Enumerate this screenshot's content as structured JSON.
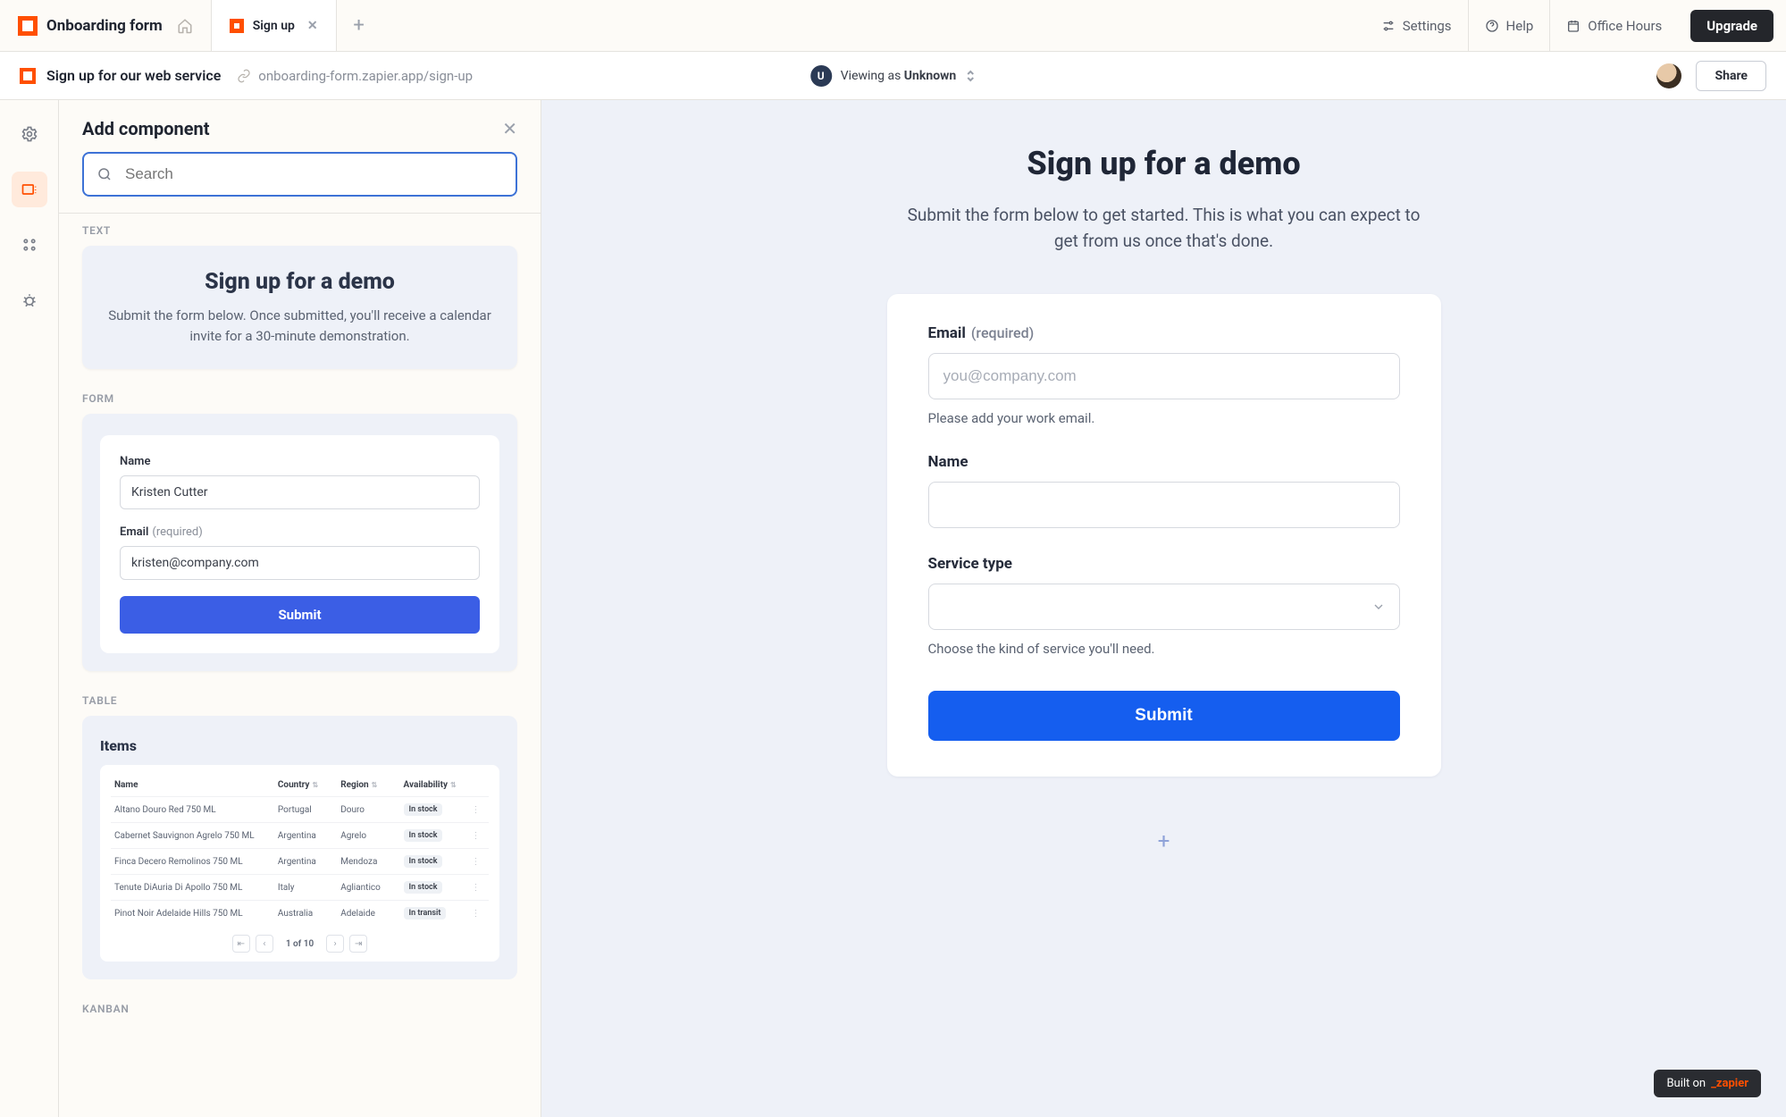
{
  "tabs": {
    "root": "Onboarding form",
    "active": "Sign up"
  },
  "top_links": {
    "settings": "Settings",
    "help": "Help",
    "office_hours": "Office Hours",
    "upgrade": "Upgrade"
  },
  "subbar": {
    "title": "Sign up for our web service",
    "url": "onboarding-form.zapier.app/sign-up",
    "viewing_prefix": "Viewing as ",
    "viewing_user": "Unknown",
    "share": "Share"
  },
  "panel": {
    "title": "Add component",
    "search_placeholder": "Search",
    "sections": {
      "text": "TEXT",
      "form": "FORM",
      "table": "TABLE",
      "kanban": "KANBAN"
    },
    "text_card": {
      "heading": "Sign up for a demo",
      "body": "Submit the form below. Once submitted, you'll receive a calendar invite for a 30-minute demonstration."
    },
    "form_card": {
      "name_label": "Name",
      "name_value": "Kristen Cutter",
      "email_label": "Email",
      "email_req": "(required)",
      "email_value": "kristen@company.com",
      "submit": "Submit"
    },
    "table_card": {
      "heading": "Items",
      "cols": [
        "Name",
        "Country",
        "Region",
        "Availability"
      ],
      "rows": [
        {
          "name": "Altano Douro Red 750 ML",
          "country": "Portugal",
          "region": "Douro",
          "avail": "In stock"
        },
        {
          "name": "Cabernet Sauvignon Agrelo 750 ML",
          "country": "Argentina",
          "region": "Agrelo",
          "avail": "In stock"
        },
        {
          "name": "Finca Decero Remolinos 750 ML",
          "country": "Argentina",
          "region": "Mendoza",
          "avail": "In stock"
        },
        {
          "name": "Tenute DiAuria Di Apollo 750 ML",
          "country": "Italy",
          "region": "Agliantico",
          "avail": "In stock"
        },
        {
          "name": "Pinot Noir Adelaide Hills 750 ML",
          "country": "Australia",
          "region": "Adelaide",
          "avail": "In transit"
        }
      ],
      "pager": "1 of 10"
    }
  },
  "preview": {
    "heading": "Sign up for a demo",
    "sub": "Submit the form below to get started. This is what you can expect to get from us once that's done.",
    "email_label": "Email",
    "email_req": "(required)",
    "email_placeholder": "you@company.com",
    "email_help": "Please add your work email.",
    "name_label": "Name",
    "service_label": "Service type",
    "service_help": "Choose the kind of service you'll need.",
    "submit": "Submit"
  },
  "footer": {
    "built_on": "Built on",
    "brand": "_zapier"
  }
}
